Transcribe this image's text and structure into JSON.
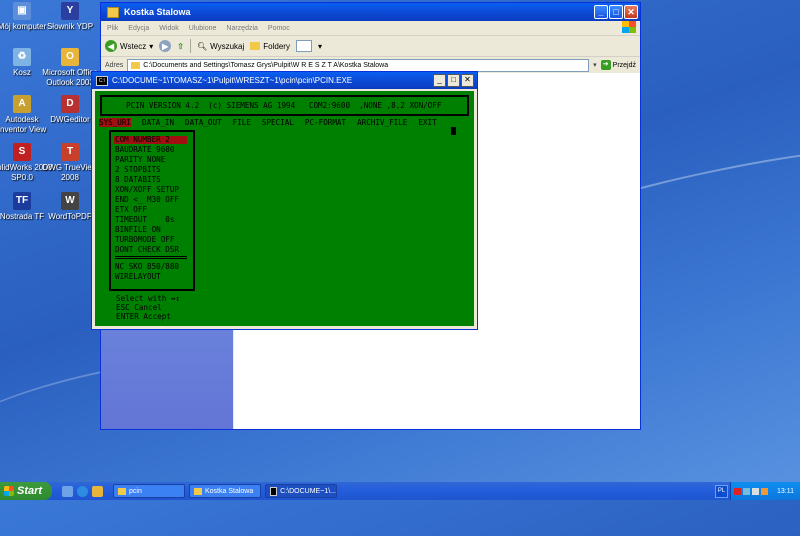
{
  "desktop_icons": [
    {
      "label": "Mój komputer",
      "color": "#5d8fd8",
      "symbol": "▣"
    },
    {
      "label": "Słownik YDP",
      "color": "#2a3fa0",
      "symbol": "Y"
    },
    {
      "label": "Kosz",
      "color": "#7fb3e3",
      "symbol": "♻"
    },
    {
      "label": "Microsoft Office Outlook 2003",
      "color": "#e8b43a",
      "symbol": "O"
    },
    {
      "label": "Autodesk Inventor View",
      "color": "#c8a030",
      "symbol": "A"
    },
    {
      "label": "DWGeditor",
      "color": "#b83030",
      "symbol": "D"
    },
    {
      "label": "SolidWorks 2008 SP0.0",
      "color": "#c02020",
      "symbol": "S"
    },
    {
      "label": "DWG TrueView 2008",
      "color": "#c8402a",
      "symbol": "T"
    },
    {
      "label": "Nostrada TF",
      "color": "#1b3c9c",
      "symbol": "TF"
    },
    {
      "label": "WordToPDF",
      "color": "#444",
      "symbol": "W"
    }
  ],
  "explorer": {
    "title": "Kostka Stalowa",
    "menu": [
      "Plik",
      "Edycja",
      "Widok",
      "Ulubione",
      "Narzędzia",
      "Pomoc"
    ],
    "toolbar": {
      "back": "Wstecz",
      "search": "Wyszukaj",
      "folders": "Foldery"
    },
    "address_label": "Adres",
    "address_value": "C:\\Documents and Settings\\Tomasz Grys\\Pulpit\\W R E S Z T A\\Kostka Stalowa",
    "go_label": "Przejdź"
  },
  "console": {
    "title": "C:\\DOCUME~1\\TOMASZ~1\\Pulpit\\WRESZT~1\\pcin\\pcin\\PCIN.EXE",
    "banner": "PCIN VERSION 4.2  (c) SIEMENS AG 1994   COM2:9600  ,NONE ,8,2 XON/OFF",
    "menu": [
      {
        "label": "SYS_URI",
        "selected": true
      },
      {
        "label": "DATA_IN",
        "selected": false
      },
      {
        "label": "DATA_OUT",
        "selected": false
      },
      {
        "label": "FILE",
        "selected": false
      },
      {
        "label": "SPECIAL",
        "selected": false
      },
      {
        "label": "PC-FORMAT",
        "selected": false
      },
      {
        "label": "ARCHIV_FILE",
        "selected": false
      },
      {
        "label": "EXIT",
        "selected": false
      }
    ],
    "submenu": [
      {
        "label": "COM NUMBER 2",
        "selected": true
      },
      {
        "label": "BAUDRATE 9600",
        "selected": false
      },
      {
        "label": "PARITY NONE",
        "selected": false
      },
      {
        "label": "2 STOPBITS",
        "selected": false
      },
      {
        "label": "8 DATABITS",
        "selected": false
      },
      {
        "label": "XON/XOFF SETUP",
        "selected": false
      },
      {
        "label": "END <_ M30 OFF",
        "selected": false
      },
      {
        "label": "ETX OFF",
        "selected": false
      },
      {
        "label": "TIMEOUT    0s",
        "selected": false
      },
      {
        "label": "BINFILE ON",
        "selected": false
      },
      {
        "label": "TURBOMODE OFF",
        "selected": false
      },
      {
        "label": "DONT CHECK DSR",
        "selected": false
      },
      {
        "label": "NC SKO 850/880",
        "selected": false
      },
      {
        "label": "WIRELAYOUT",
        "selected": false
      }
    ],
    "hints": [
      "Select with ↔↕",
      "ESC Cancel",
      "ENTER Accept"
    ]
  },
  "taskbar": {
    "start_label": "Start",
    "tasks": [
      {
        "label": "pcin",
        "type": "folder",
        "active": false
      },
      {
        "label": "Kostka Stalowa",
        "type": "folder",
        "active": false
      },
      {
        "label": "C:\\DOCUME~1\\...",
        "type": "cmd",
        "active": true
      }
    ],
    "lang": "PL",
    "clock": "13:11"
  }
}
